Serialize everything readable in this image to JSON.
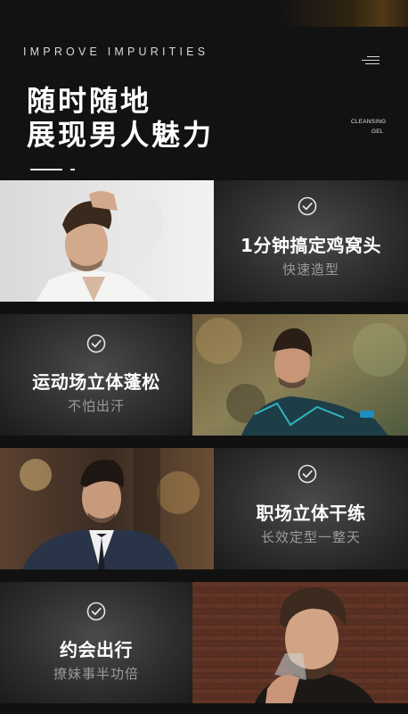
{
  "header": {
    "tagline": "IMPROVE IMPURITIES",
    "headline": [
      "随时随地",
      "展现男人魅力"
    ],
    "brand_mini": [
      "CLEANSING",
      "GEL"
    ]
  },
  "sections": [
    {
      "title": "1分钟搞定鸡窝头",
      "subtitle": "快速造型",
      "photo": "man-styling-hair-white-shirt"
    },
    {
      "title": "运动场立体蓬松",
      "subtitle": "不怕出汗",
      "photo": "man-sport-shirt-outdoors"
    },
    {
      "title": "职场立体干练",
      "subtitle": "长效定型一整天",
      "photo": "man-in-suit-pompadour"
    },
    {
      "title": "约会出行",
      "subtitle": "撩妹事半功倍",
      "photo": "man-drinking-glass-brick-wall"
    }
  ],
  "icons": {
    "check": "check-circle-icon",
    "menu": "menu-icon"
  },
  "colors": {
    "background": "#111112",
    "panel": "#3a3a3b",
    "subtitle": "#9a9a9a"
  }
}
